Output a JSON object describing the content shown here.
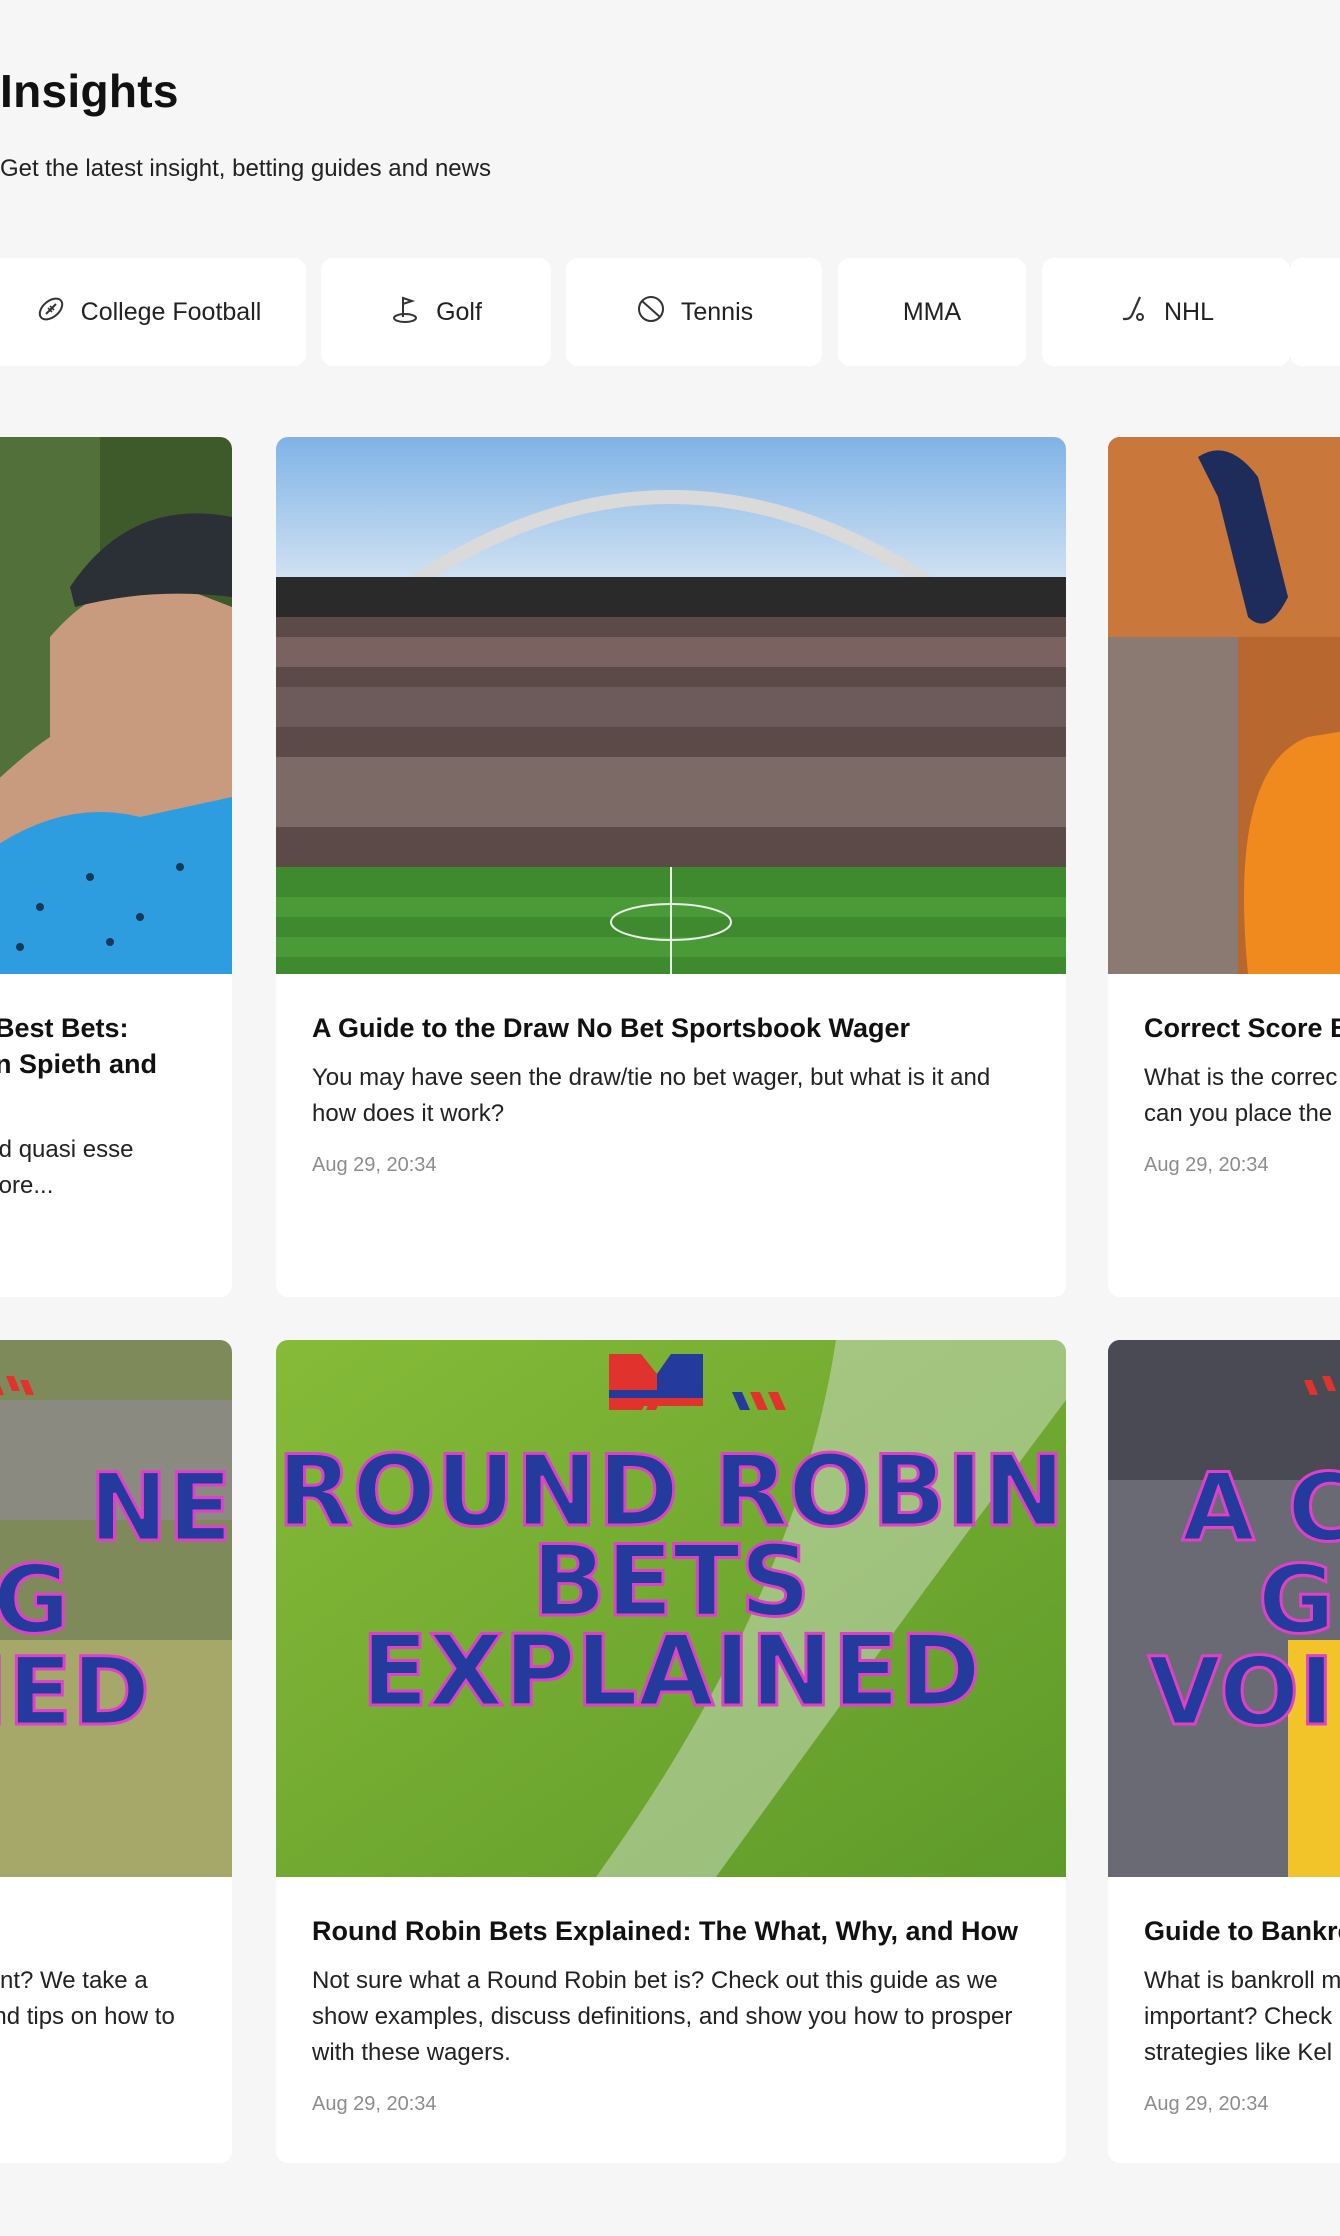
{
  "header": {
    "title": "Insights",
    "subtitle": "Get the latest insight, betting guides and news"
  },
  "categories": [
    {
      "label": "College Football",
      "icon": "football-icon"
    },
    {
      "label": "Golf",
      "icon": "golf-icon"
    },
    {
      "label": "Tennis",
      "icon": "tennis-icon"
    },
    {
      "label": "MMA",
      "icon": ""
    },
    {
      "label": "NHL",
      "icon": "hockey-icon"
    }
  ],
  "articles": [
    {
      "title": ", Best Bets:",
      "title2": "an Spieth and",
      "excerpt": "uid quasi esse",
      "excerpt2": "plore...",
      "image": "golfer-photo"
    },
    {
      "title": "A Guide to the Draw No Bet Sportsbook Wager",
      "excerpt": "You may have seen the draw/tie no bet wager, but what is it and how does it work?",
      "date": "Aug 29, 20:34",
      "image": "stadium-photo"
    },
    {
      "title": "Correct Score B",
      "excerpt": "What is the correc",
      "excerpt2": "can you place the",
      "date": "Aug 29, 20:34",
      "image": "mascot-photo"
    },
    {
      "excerpt": "tant? We take a",
      "excerpt2": "and tips on how to",
      "image_text": [
        "NE",
        "G",
        "NED"
      ],
      "image": "guide-graphic"
    },
    {
      "title": "Round Robin Bets Explained: The What, Why, and How",
      "excerpt": "Not sure what a Round Robin bet is? Check out this guide as we show examples, discuss definitions, and show you how to prosper with these wagers.",
      "date": "Aug 29, 20:34",
      "image_text": [
        "ROUND ROBIN",
        "BETS",
        "EXPLAINED"
      ],
      "image": "round-robin-graphic"
    },
    {
      "title": "Guide to Bankro",
      "excerpt": "What is bankroll m",
      "excerpt2": "important? Check",
      "excerpt3": "strategies like Kel",
      "date": "Aug 29, 20:34",
      "image_text": [
        "A C",
        "GU",
        "VOI"
      ],
      "image": "crowd-graphic"
    }
  ],
  "colors": {
    "background": "#f6f6f6",
    "card": "#ffffff",
    "graphic_text": "#243a9c",
    "graphic_outline": "#e040c8",
    "graphic_red": "#e0332d"
  }
}
